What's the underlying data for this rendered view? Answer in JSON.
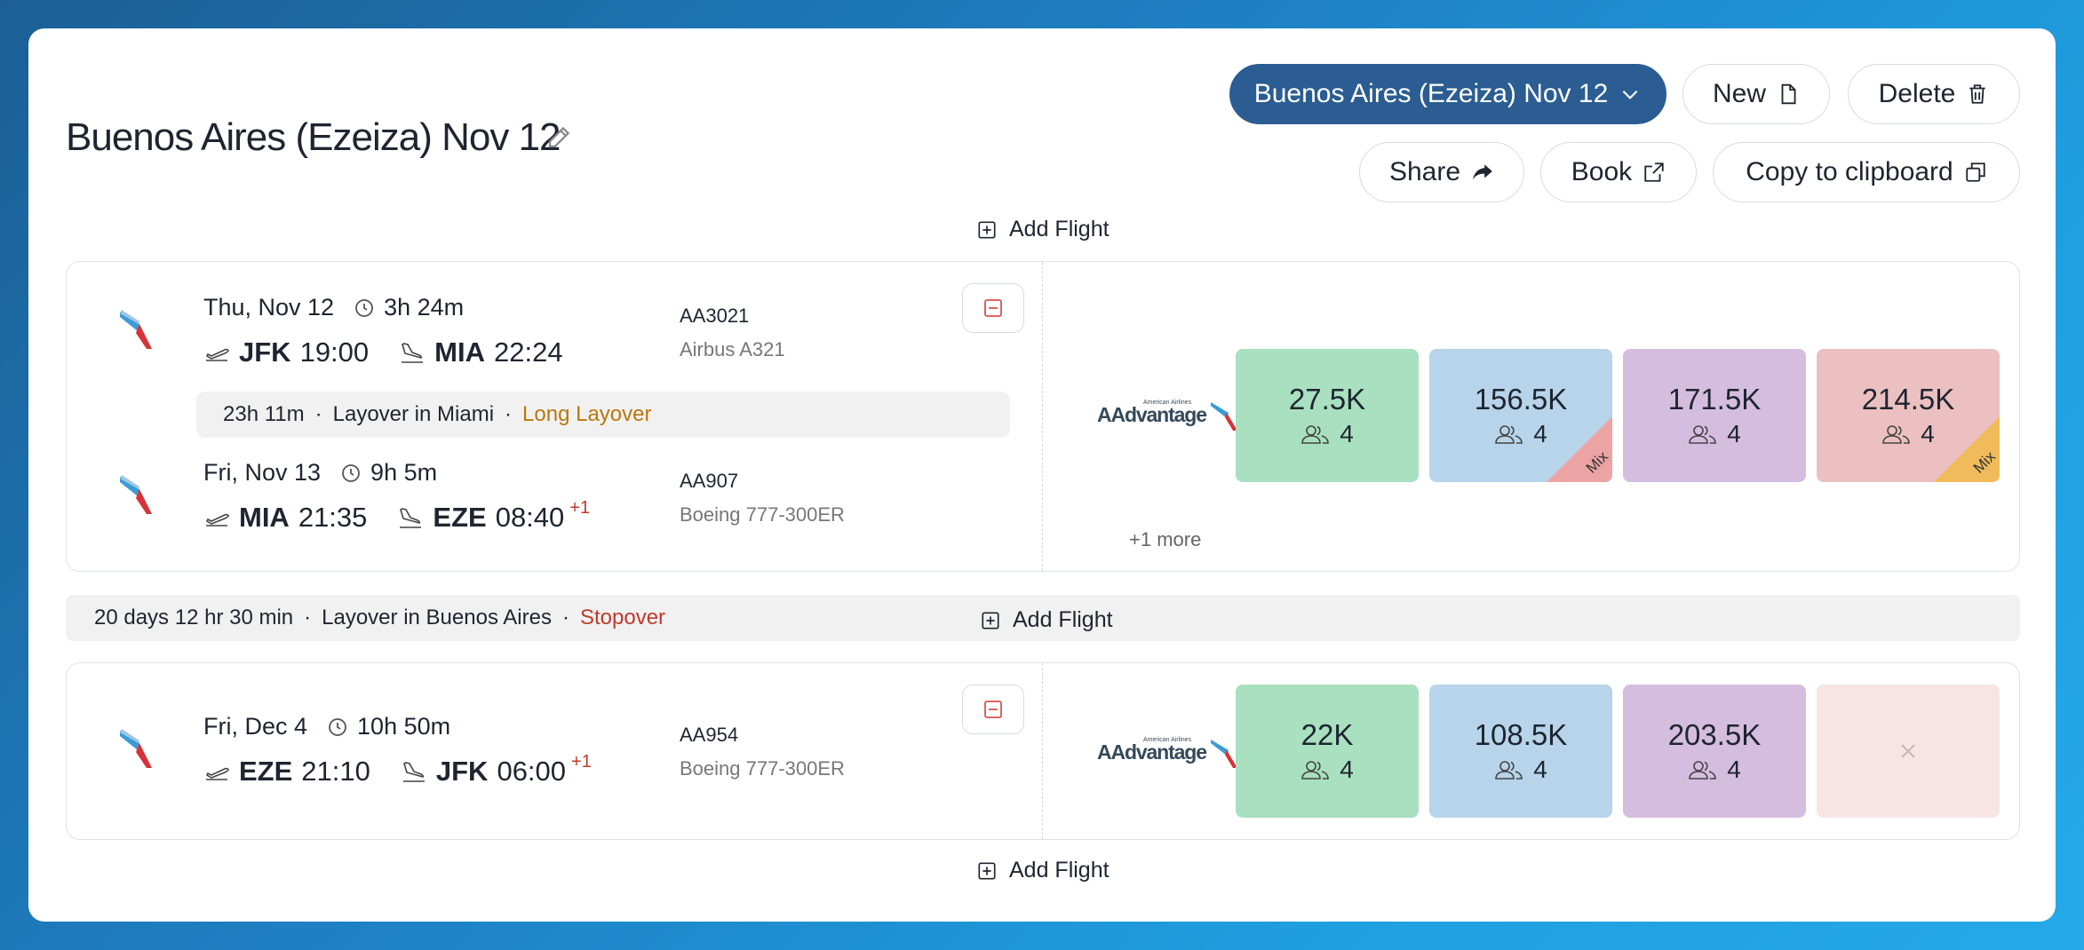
{
  "title": "Buenos Aires (Ezeiza) Nov 12",
  "toolbar": {
    "trip_select": "Buenos Aires (Ezeiza) Nov 12",
    "new": "New",
    "delete": "Delete",
    "share": "Share",
    "book": "Book",
    "copy": "Copy to clipboard"
  },
  "add_flight": "Add Flight",
  "separator": "·",
  "segments": [
    {
      "legs": [
        {
          "date": "Thu, Nov 12",
          "duration": "3h 24m",
          "from": "JFK",
          "dep": "19:00",
          "to": "MIA",
          "arr": "22:24",
          "day_offset": "",
          "flight": "AA3021",
          "aircraft": "Airbus A321"
        },
        {
          "date": "Fri, Nov 13",
          "duration": "9h 5m",
          "from": "MIA",
          "dep": "21:35",
          "to": "EZE",
          "arr": "08:40",
          "day_offset": "+1",
          "flight": "AA907",
          "aircraft": "Boeing 777-300ER"
        }
      ],
      "layover": {
        "duration": "23h 11m",
        "place": "Layover in Miami",
        "note": "Long Layover"
      },
      "awards": [
        {
          "points": "27.5K",
          "seats": "4",
          "color": "#a8e0c0",
          "mix": false
        },
        {
          "points": "156.5K",
          "seats": "4",
          "color": "#b7d4ea",
          "mix": true,
          "mix_color": "#eca3a3",
          "mix_label": "Mix"
        },
        {
          "points": "171.5K",
          "seats": "4",
          "color": "#d5bde0",
          "mix": false
        },
        {
          "points": "214.5K",
          "seats": "4",
          "color": "#ecc0c0",
          "mix": true,
          "mix_color": "#f0bb5a",
          "mix_label": "Mix"
        }
      ],
      "more": "+1 more"
    },
    {
      "legs": [
        {
          "date": "Fri, Dec 4",
          "duration": "10h 50m",
          "from": "EZE",
          "dep": "21:10",
          "to": "JFK",
          "arr": "06:00",
          "day_offset": "+1",
          "flight": "AA954",
          "aircraft": "Boeing 777-300ER"
        }
      ],
      "awards": [
        {
          "points": "22K",
          "seats": "4",
          "color": "#a8e0c0",
          "mix": false
        },
        {
          "points": "108.5K",
          "seats": "4",
          "color": "#b7d4ea",
          "mix": false
        },
        {
          "points": "203.5K",
          "seats": "4",
          "color": "#d5bde0",
          "mix": false
        }
      ],
      "unavailable_color": "#f7e5e5"
    }
  ],
  "stopover": {
    "duration": "20 days 12 hr 30 min",
    "place": "Layover in Buenos Aires",
    "note": "Stopover"
  },
  "icons": {
    "edit": "pencil-icon",
    "new": "file-icon",
    "delete": "trash-icon",
    "share": "share-arrow-icon",
    "book": "external-link-icon",
    "copy": "copy-icon",
    "add": "plus-square-icon",
    "remove": "minus-square-icon",
    "clock": "clock-icon",
    "takeoff": "takeoff-icon",
    "landing": "landing-icon",
    "seats": "people-icon",
    "unavailable": "x-icon"
  }
}
